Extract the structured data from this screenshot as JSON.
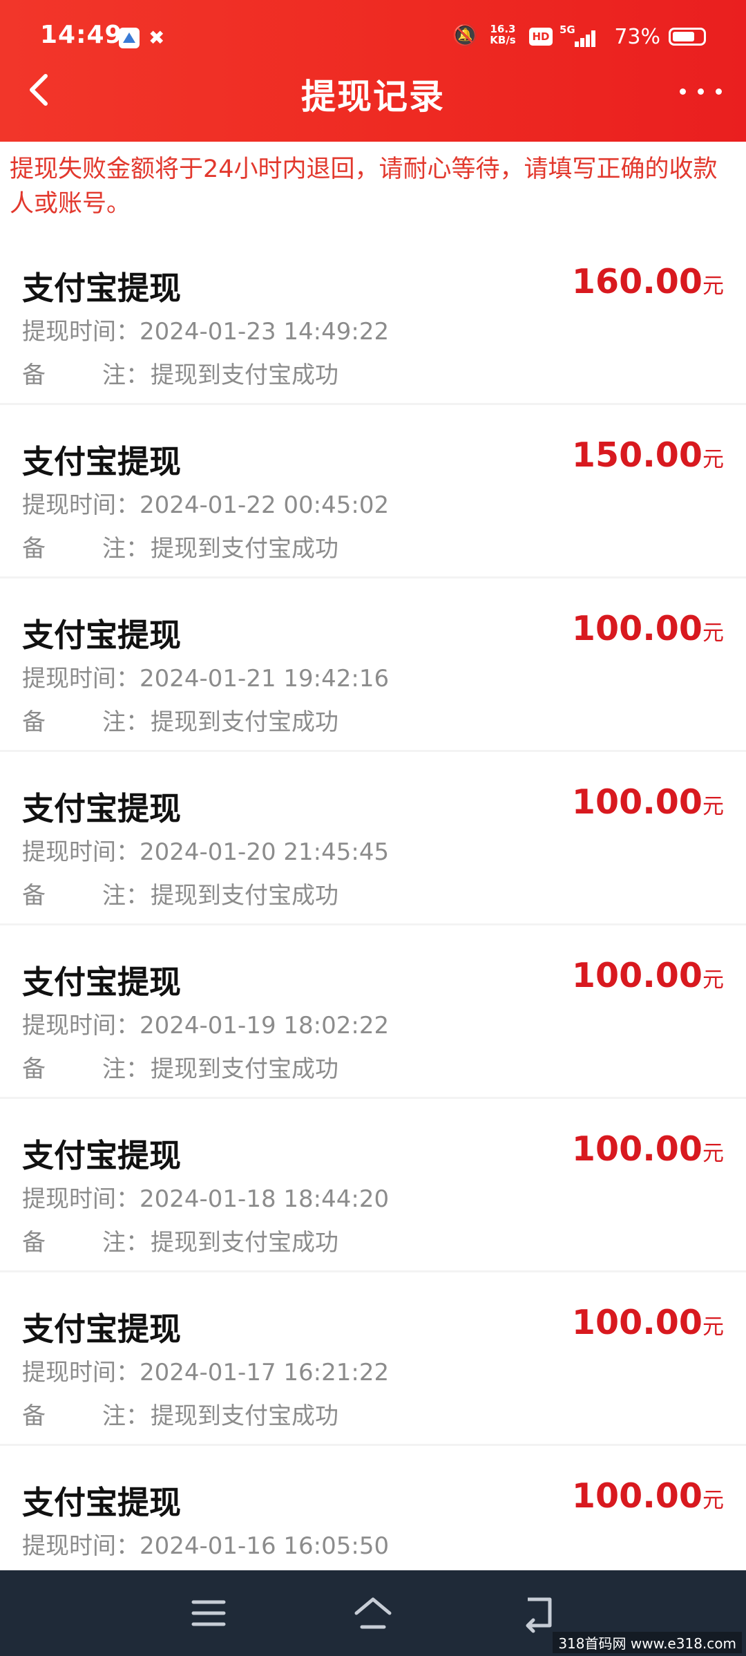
{
  "status_bar": {
    "time": "14:49",
    "net_speed_value": "16.3",
    "net_speed_unit": "KB/s",
    "hd_label": "HD",
    "network_label": "5G",
    "battery_percent": "73%",
    "battery_level": 0.73
  },
  "nav": {
    "title": "提现记录",
    "back_icon": "chevron-left-icon",
    "more_icon": "more-dots-icon"
  },
  "notice": "提现失败金额将于24小时内退回，请耐心等待，请填写正确的收款人或账号。",
  "records": [
    {
      "title": "支付宝提现",
      "amount": "160.00",
      "unit": "元",
      "time_label": "提现时间：",
      "time": "2024-01-23 14:49:22",
      "note_label_a": "备",
      "note_label_b": "注：",
      "note": "提现到支付宝成功"
    },
    {
      "title": "支付宝提现",
      "amount": "150.00",
      "unit": "元",
      "time_label": "提现时间：",
      "time": "2024-01-22 00:45:02",
      "note_label_a": "备",
      "note_label_b": "注：",
      "note": "提现到支付宝成功"
    },
    {
      "title": "支付宝提现",
      "amount": "100.00",
      "unit": "元",
      "time_label": "提现时间：",
      "time": "2024-01-21 19:42:16",
      "note_label_a": "备",
      "note_label_b": "注：",
      "note": "提现到支付宝成功"
    },
    {
      "title": "支付宝提现",
      "amount": "100.00",
      "unit": "元",
      "time_label": "提现时间：",
      "time": "2024-01-20 21:45:45",
      "note_label_a": "备",
      "note_label_b": "注：",
      "note": "提现到支付宝成功"
    },
    {
      "title": "支付宝提现",
      "amount": "100.00",
      "unit": "元",
      "time_label": "提现时间：",
      "time": "2024-01-19 18:02:22",
      "note_label_a": "备",
      "note_label_b": "注：",
      "note": "提现到支付宝成功"
    },
    {
      "title": "支付宝提现",
      "amount": "100.00",
      "unit": "元",
      "time_label": "提现时间：",
      "time": "2024-01-18 18:44:20",
      "note_label_a": "备",
      "note_label_b": "注：",
      "note": "提现到支付宝成功"
    },
    {
      "title": "支付宝提现",
      "amount": "100.00",
      "unit": "元",
      "time_label": "提现时间：",
      "time": "2024-01-17 16:21:22",
      "note_label_a": "备",
      "note_label_b": "注：",
      "note": "提现到支付宝成功"
    },
    {
      "title": "支付宝提现",
      "amount": "100.00",
      "unit": "元",
      "time_label": "提现时间：",
      "time": "2024-01-16 16:05:50",
      "note_label_a": "",
      "note_label_b": "",
      "note": ""
    }
  ],
  "bottom_nav": {
    "menu_icon": "menu-icon",
    "home_icon": "home-icon",
    "back_icon": "back-arrow-icon"
  },
  "watermark": "318首码网 www.e318.com",
  "colors": {
    "header": "#ee2a22",
    "amount": "#d8191f",
    "notice": "#e2382d",
    "bottom_nav": "#1f2a38"
  }
}
